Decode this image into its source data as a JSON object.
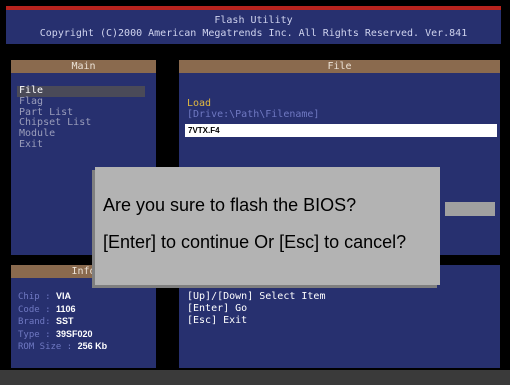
{
  "header": {
    "title": "Flash Utility",
    "copyright": "Copyright (C)2000 American Megatrends Inc. All Rights Reserved. Ver.841"
  },
  "main_panel": {
    "title": "Main",
    "items": [
      {
        "label": "File",
        "active": true
      },
      {
        "label": "Flag",
        "active": false
      },
      {
        "label": "Part List",
        "active": false
      },
      {
        "label": "Chipset List",
        "active": false
      },
      {
        "label": "Module",
        "active": false
      },
      {
        "label": "Exit",
        "active": false
      }
    ]
  },
  "file_panel": {
    "title": "File",
    "load_label": "Load",
    "path_hint": "[Drive:\\Path\\Filename]",
    "filename_value": "7VTX.F4"
  },
  "info_panel": {
    "title": "Info",
    "rows": [
      {
        "label": "Chip  : ",
        "value": "VIA"
      },
      {
        "label": "Code  : ",
        "value": "1106"
      },
      {
        "label": "Brand: ",
        "value": "SST"
      },
      {
        "label": "Type  : ",
        "value": "39SF020"
      },
      {
        "label": "ROM Size : ",
        "value": "256 Kb"
      }
    ]
  },
  "keys_panel": {
    "lines": [
      "[Up]/[Down] Select Item",
      "[Enter] Go",
      "[Esc] Exit"
    ]
  },
  "dialog": {
    "question": "Are you sure to flash the BIOS?",
    "instruction": "[Enter] to continue Or [Esc] to cancel?"
  },
  "colors": {
    "panel_bg": "#27306f",
    "title_bar": "#8a6a4e",
    "header_accent": "#b8241e",
    "dialog_bg": "#b3b3b3",
    "active_item_bg": "#4a4a58"
  }
}
